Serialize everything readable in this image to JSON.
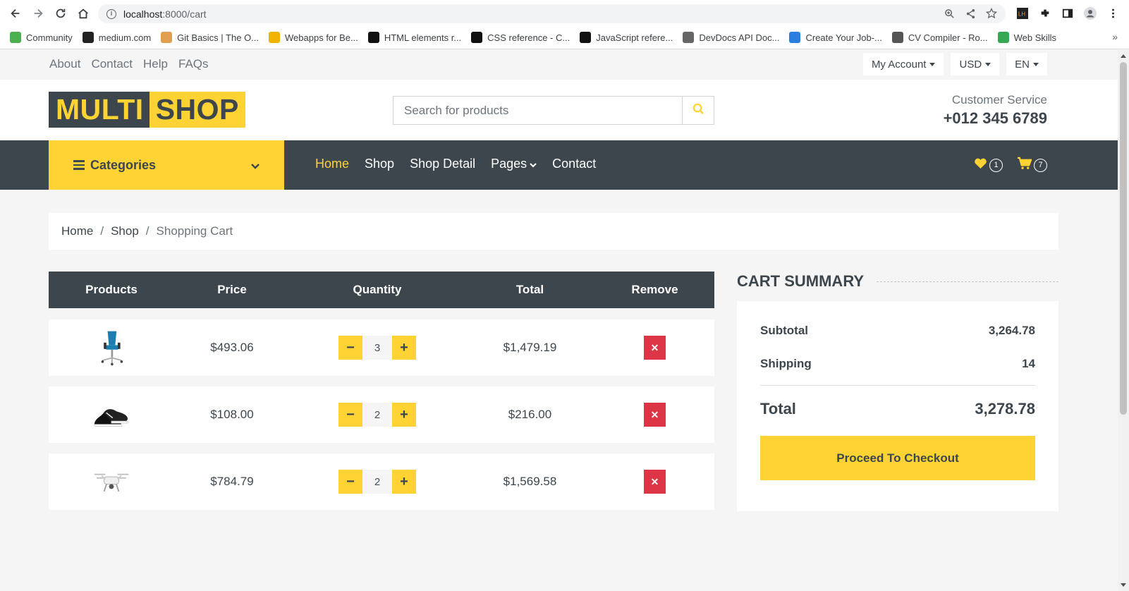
{
  "browser": {
    "url_host": "localhost",
    "url_path": ":8000/cart",
    "bookmarks": [
      {
        "label": "Community",
        "color": "#4caf50"
      },
      {
        "label": "medium.com",
        "color": "#222222"
      },
      {
        "label": "Git Basics | The O...",
        "color": "#e0a050"
      },
      {
        "label": "Webapps for Be...",
        "color": "#f0b400"
      },
      {
        "label": "HTML elements r...",
        "color": "#111111"
      },
      {
        "label": "CSS reference - C...",
        "color": "#111111"
      },
      {
        "label": "JavaScript refere...",
        "color": "#111111"
      },
      {
        "label": "DevDocs API Doc...",
        "color": "#666666"
      },
      {
        "label": "Create Your Job-...",
        "color": "#2a7de1"
      },
      {
        "label": "CV Compiler - Ro...",
        "color": "#555555"
      },
      {
        "label": "Web Skills",
        "color": "#34a853"
      }
    ],
    "more": "»"
  },
  "topbar": {
    "links": [
      "About",
      "Contact",
      "Help",
      "FAQs"
    ],
    "account": "My Account",
    "currency": "USD",
    "language": "EN"
  },
  "header": {
    "logo_part1": "MULTI",
    "logo_part2": "SHOP",
    "search_placeholder": "Search for products",
    "service_label": "Customer Service",
    "service_phone": "+012 345 6789"
  },
  "nav": {
    "categories": "Categories",
    "items": [
      "Home",
      "Shop",
      "Shop Detail",
      "Pages",
      "Contact"
    ],
    "wishlist_count": "1",
    "cart_count": "7"
  },
  "breadcrumb": {
    "home": "Home",
    "shop": "Shop",
    "current": "Shopping Cart",
    "sep": "/"
  },
  "cart": {
    "headers": [
      "Products",
      "Price",
      "Quantity",
      "Total",
      "Remove"
    ],
    "rows": [
      {
        "product": "chair",
        "price": "$493.06",
        "qty": "3",
        "total": "$1,479.19"
      },
      {
        "product": "shoes",
        "price": "$108.00",
        "qty": "2",
        "total": "$216.00"
      },
      {
        "product": "drone",
        "price": "$784.79",
        "qty": "2",
        "total": "$1,569.58"
      }
    ]
  },
  "summary": {
    "title": "CART SUMMARY",
    "subtotal_label": "Subtotal",
    "subtotal": "3,264.78",
    "shipping_label": "Shipping",
    "shipping": "14",
    "total_label": "Total",
    "total": "3,278.78",
    "checkout": "Proceed To Checkout"
  },
  "colors": {
    "primary": "#ffd333",
    "dark": "#3d464d",
    "danger": "#dc3545"
  }
}
